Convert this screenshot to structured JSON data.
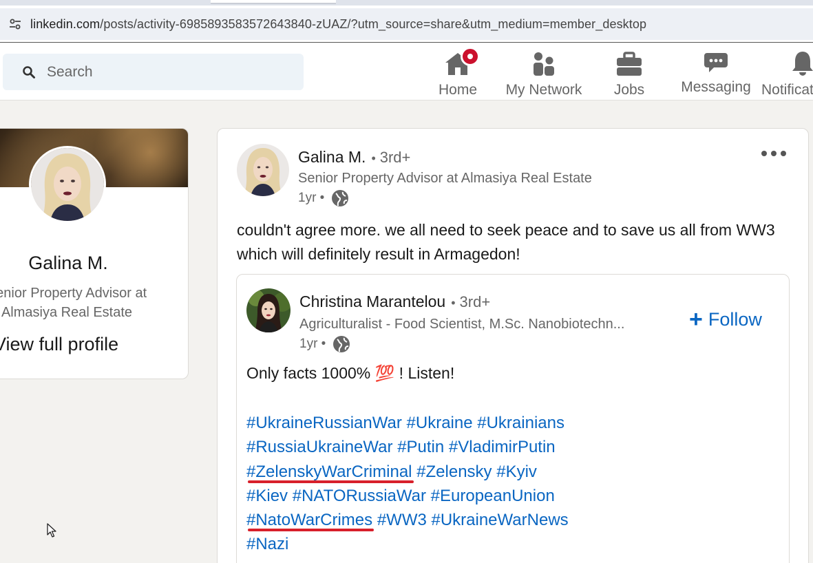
{
  "browser": {
    "url_host": "linkedin.com",
    "url_path": "/posts/activity-6985893583572643840-zUAZ/?utm_source=share&utm_medium=member_desktop",
    "site_info_icon": "tune-icon"
  },
  "nav": {
    "search_placeholder": "Search",
    "items": [
      {
        "label": "Home",
        "icon": "home-icon",
        "has_notification": true
      },
      {
        "label": "My Network",
        "icon": "network-icon"
      },
      {
        "label": "Jobs",
        "icon": "briefcase-icon"
      },
      {
        "label": "Messaging",
        "icon": "messaging-icon"
      },
      {
        "label": "Notificat",
        "icon": "bell-icon"
      }
    ]
  },
  "profile_card": {
    "name": "Galina M.",
    "headline_line1": "Senior Property Advisor at",
    "headline_line2": "Almasiya Real Estate",
    "view_profile": "View full profile"
  },
  "post": {
    "author": "Galina M.",
    "separator": "•",
    "degree": "3rd+",
    "headline": "Senior Property Advisor at Almasiya Real Estate",
    "time": "1yr •",
    "commentary": "couldn't agree more. we all need to seek peace and to save us all from WW3 which will definitely result in Armagedon!",
    "reshare": {
      "author": "Christina Marantelou",
      "separator": "•",
      "degree": "3rd+",
      "headline": "Agriculturalist - Food Scientist, M.Sc. Nanobiotechn...",
      "time": "1yr •",
      "follow_label": "Follow",
      "text": "Only facts 1000% 💯 ! Listen!",
      "hashtag_lines": [
        [
          "#UkraineRussianWar",
          "#Ukraine",
          "#Ukrainians"
        ],
        [
          "#RussiaUkraineWar",
          "#Putin",
          "#VladimirPutin"
        ],
        [
          "#ZelenskyWarCriminal",
          "#Zelensky",
          "#Kyiv"
        ],
        [
          "#Kiev",
          "#NATORussiaWar",
          "#EuropeanUnion"
        ],
        [
          "#NatoWarCrimes",
          "#WW3",
          "#UkraineWarNews"
        ],
        [
          "#Nazi"
        ]
      ],
      "underlined_tags": [
        "#ZelenskyWarCriminal",
        "#NatoWarCrimes"
      ]
    }
  },
  "colors": {
    "link": "#0a66c2",
    "badge": "#cb112d",
    "annotation_underline": "#d8202b"
  }
}
